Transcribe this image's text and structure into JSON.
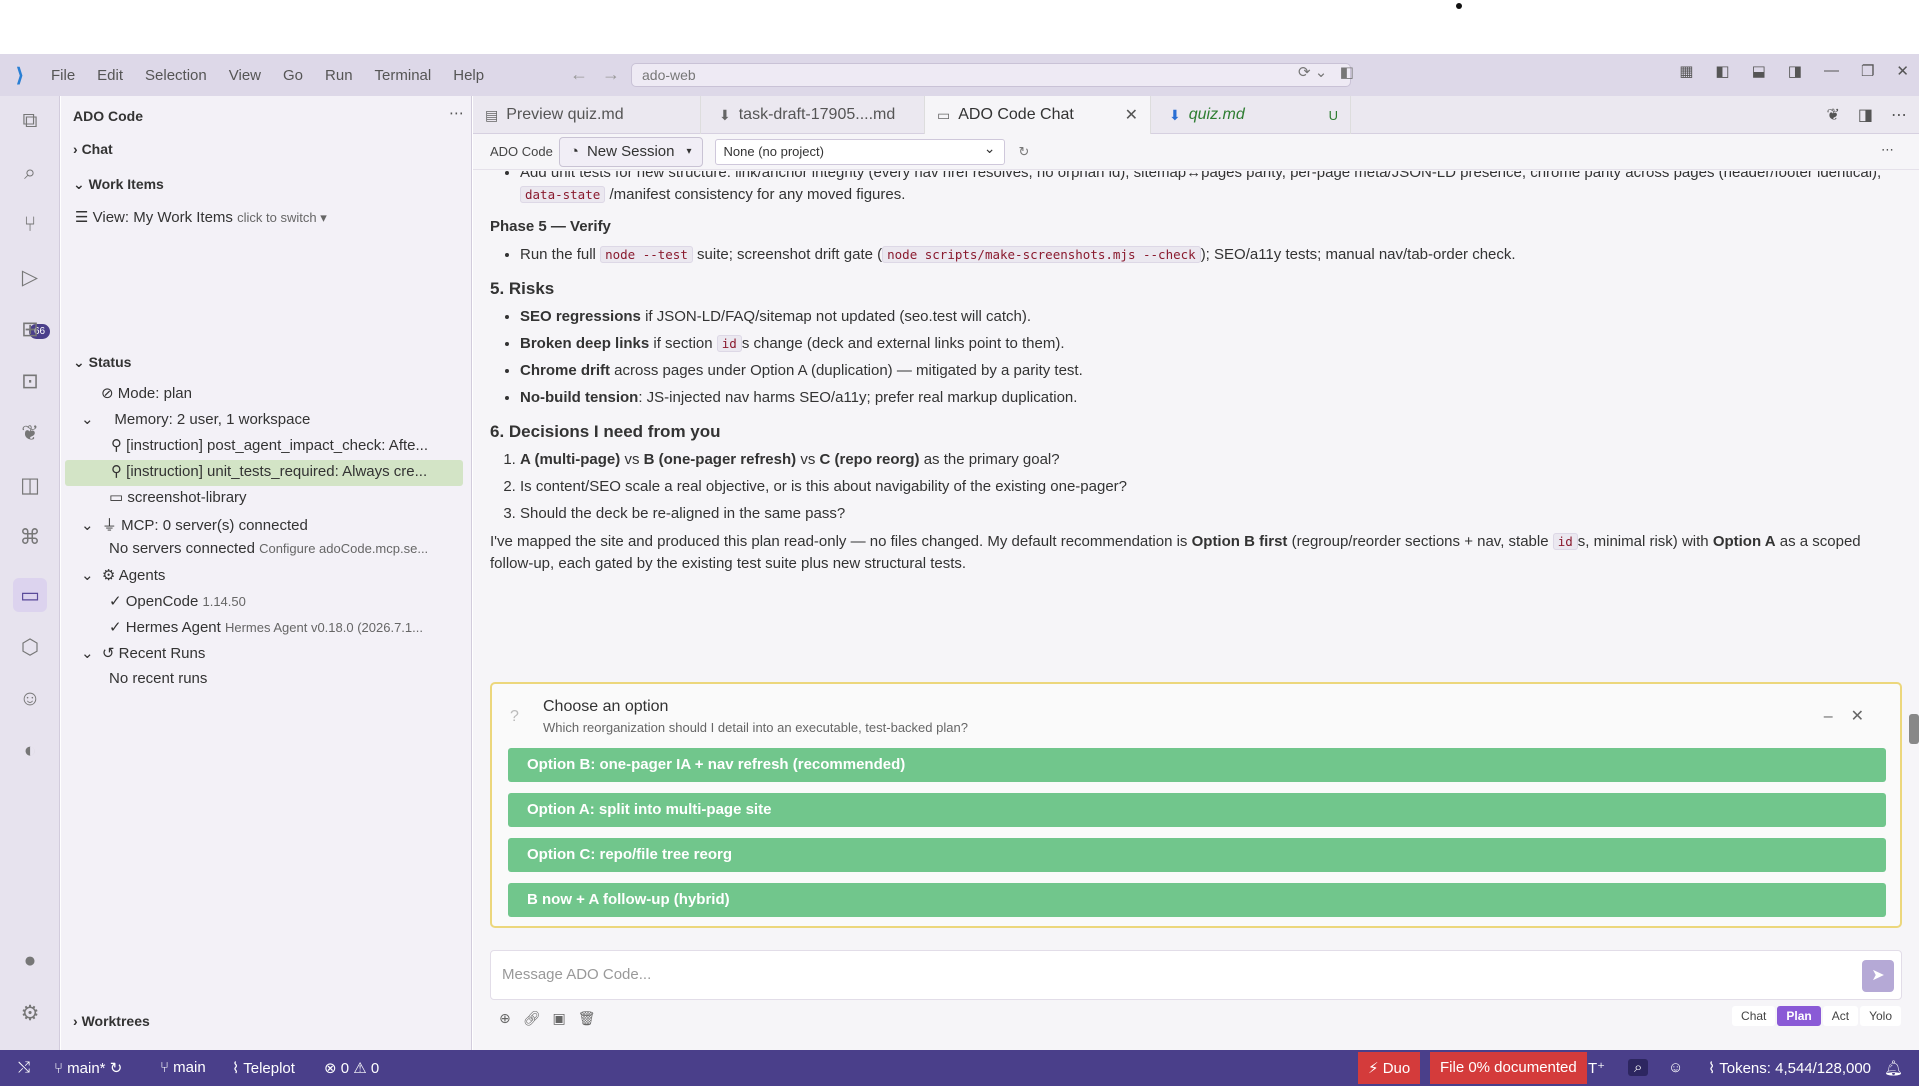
{
  "window": {
    "menu": [
      "File",
      "Edit",
      "Selection",
      "View",
      "Go",
      "Run",
      "Terminal",
      "Help"
    ],
    "search": "ado-web"
  },
  "activity": {
    "badge": "66"
  },
  "sidebar": {
    "title": "ADO Code",
    "chat": "Chat",
    "work_items": "Work Items",
    "view": "View: My Work Items",
    "view_hint": "click to switch",
    "status": "Status",
    "mode": "Mode: plan",
    "memory": "Memory: 2 user, 1 workspace",
    "mem1": "[instruction] post_agent_impact_check: Afte...",
    "mem2": "[instruction] unit_tests_required: Always cre...",
    "mem3": "screenshot-library",
    "mcp": "MCP: 0 server(s) connected",
    "mcp_none": "No servers connected",
    "mcp_cfg": "Configure adoCode.mcp.se...",
    "agents": "Agents",
    "agent1": "OpenCode",
    "agent1_ver": "1.14.50",
    "agent2": "Hermes Agent",
    "agent2_ver": "Hermes Agent v0.18.0 (2026.7.1...",
    "runs": "Recent Runs",
    "runs_none": "No recent runs",
    "worktrees": "Worktrees"
  },
  "tabs": [
    {
      "label": "Preview quiz.md"
    },
    {
      "label": "task-draft-17905....md"
    },
    {
      "label": "ADO Code Chat"
    },
    {
      "label": "quiz.md",
      "status": "U"
    }
  ],
  "toolbar": {
    "label": "ADO Code",
    "session": "New Session",
    "project": "None (no project)"
  },
  "chat": {
    "top_line": "Add unit tests for new structure: link/anchor integrity (every nav href resolves, no orphan id), sitemap↔pages parity, per-page meta/JSON-LD presence, chrome parity across pages (header/footer identical),",
    "top_code": "data-state",
    "top_tail": "/manifest consistency for any moved figures.",
    "phase5": "Phase 5 — Verify",
    "p5_a": "Run the full",
    "p5_code1": "node --test",
    "p5_b": "suite; screenshot drift gate (",
    "p5_code2": "node scripts/make-screenshots.mjs --check",
    "p5_c": "); SEO/a11y tests; manual nav/tab-order check.",
    "risks_h": "5. Risks",
    "r1_b": "SEO regressions",
    "r1": "if JSON-LD/FAQ/sitemap not updated (seo.test will catch).",
    "r2_b": "Broken deep links",
    "r2a": "if section",
    "r2_code": "id",
    "r2b": "s change (deck and external links point to them).",
    "r3_b": "Chrome drift",
    "r3": "across pages under Option A (duplication) — mitigated by a parity test.",
    "r4_b": "No-build tension",
    "r4": ": JS-injected nav harms SEO/a11y; prefer real markup duplication.",
    "dec_h": "6. Decisions I need from you",
    "d1_a": "A (multi-page)",
    "d1_vs1": "vs",
    "d1_b": "B (one-pager refresh)",
    "d1_vs2": "vs",
    "d1_c": "C (repo reorg)",
    "d1_t": "as the primary goal?",
    "d2": "Is content/SEO scale a real objective, or is this about navigability of the existing one-pager?",
    "d3": "Should the deck be re-aligned in the same pass?",
    "sum_a": "I've mapped the site and produced this plan read-only — no files changed. My default recommendation is",
    "sum_b": "Option B first",
    "sum_c": "(regroup/reorder sections + nav, stable",
    "sum_code": "id",
    "sum_d": "s, minimal risk) with",
    "sum_e": "Option A",
    "sum_f": "as a scoped follow-up, each gated by the existing test suite plus new structural tests."
  },
  "choice": {
    "title": "Choose an option",
    "subtitle": "Which reorganization should I detail into an executable, test-backed plan?",
    "options": [
      "Option B: one-pager IA + nav refresh (recommended)",
      "Option A: split into multi-page site",
      "Option C: repo/file tree reorg",
      "B now + A follow-up (hybrid)"
    ]
  },
  "input": {
    "placeholder": "Message ADO Code..."
  },
  "modes": [
    "Chat",
    "Plan",
    "Act",
    "Yolo"
  ],
  "status": {
    "branch1": "main*",
    "branch2": "main",
    "teleplot": "Teleplot",
    "errors": "0",
    "warnings": "0",
    "duo": "Duo",
    "doc": "File 0% documented",
    "tokens": "Tokens: 4,544/128,000"
  }
}
